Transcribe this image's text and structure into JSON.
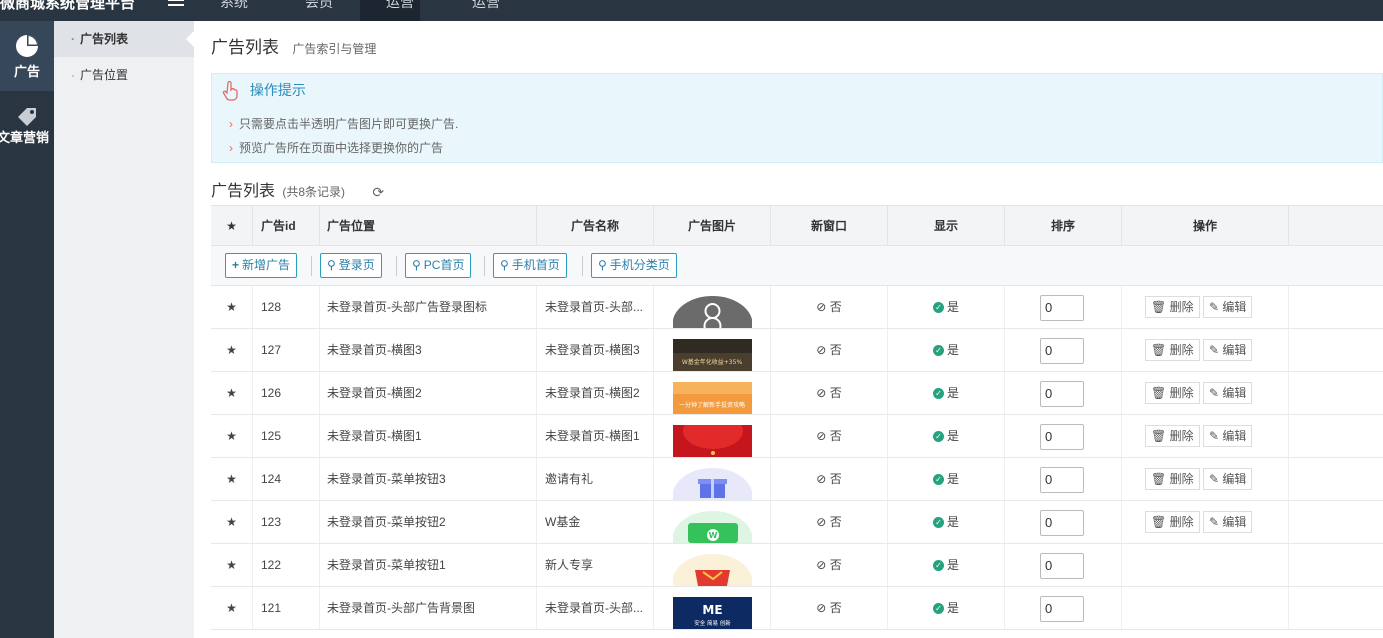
{
  "topbar": {
    "brand": "微商城系统管理平台",
    "nav": [
      "系统",
      "会员",
      "运营",
      "运营"
    ]
  },
  "rail": {
    "items": [
      {
        "label": "广告",
        "icon": "pie-chart-icon"
      },
      {
        "label": "文章营销",
        "icon": "tag-icon"
      }
    ]
  },
  "subnav": {
    "items": [
      "广告列表",
      "广告位置"
    ]
  },
  "page": {
    "title": "广告列表",
    "subtitle": "广告索引与管理"
  },
  "tips": {
    "title": "操作提示",
    "items": [
      "只需要点击半透明广告图片即可更换广告.",
      "预览广告所在页面中选择更换你的广告"
    ]
  },
  "list": {
    "title": "广告列表",
    "count": "(共8条记录)"
  },
  "columns": [
    "广告id",
    "广告位置",
    "广告名称",
    "广告图片",
    "新窗口",
    "显示",
    "排序",
    "操作"
  ],
  "toolbar": {
    "add": "新增广告",
    "filters": [
      "登录页",
      "PC首页",
      "手机首页",
      "手机分类页"
    ]
  },
  "labels": {
    "no": "否",
    "yes": "是",
    "delete": "删除",
    "edit": "编辑"
  },
  "colors": {
    "accent": "#2a9fbf",
    "yes": "#27a27f",
    "topbar": "#2a3542"
  },
  "rows": [
    {
      "id": "128",
      "position": "未登录首页-头部广告登录图标",
      "name": "未登录首页-头部...",
      "sort": "0",
      "img": "avatar-icon-image",
      "actions": true
    },
    {
      "id": "127",
      "position": "未登录首页-横图3",
      "name": "未登录首页-横图3",
      "sort": "0",
      "img": "dark-banner-image",
      "actions": true
    },
    {
      "id": "126",
      "position": "未登录首页-横图2",
      "name": "未登录首页-横图2",
      "sort": "0",
      "img": "orange-banner-image",
      "actions": true
    },
    {
      "id": "125",
      "position": "未登录首页-横图1",
      "name": "未登录首页-横图1",
      "sort": "0",
      "img": "red-banner-image",
      "actions": true
    },
    {
      "id": "124",
      "position": "未登录首页-菜单按钮3",
      "name": "邀请有礼",
      "sort": "0",
      "img": "gift-icon-image",
      "actions": true
    },
    {
      "id": "123",
      "position": "未登录首页-菜单按钮2",
      "name": "W基金",
      "sort": "0",
      "img": "wallet-icon-image",
      "actions": true
    },
    {
      "id": "122",
      "position": "未登录首页-菜单按钮1",
      "name": "新人专享",
      "sort": "0",
      "img": "redpacket-icon-image",
      "actions": false
    },
    {
      "id": "121",
      "position": "未登录首页-头部广告背景图",
      "name": "未登录首页-头部...",
      "sort": "0",
      "img": "navy-banner-image",
      "actions": false
    }
  ],
  "banner_texts": {
    "r127": "W基金年化收益+35%",
    "r126": "一分钟了解新手投资攻略",
    "r121_logo": "ME",
    "r121_sub": "安全 简易 创新"
  }
}
